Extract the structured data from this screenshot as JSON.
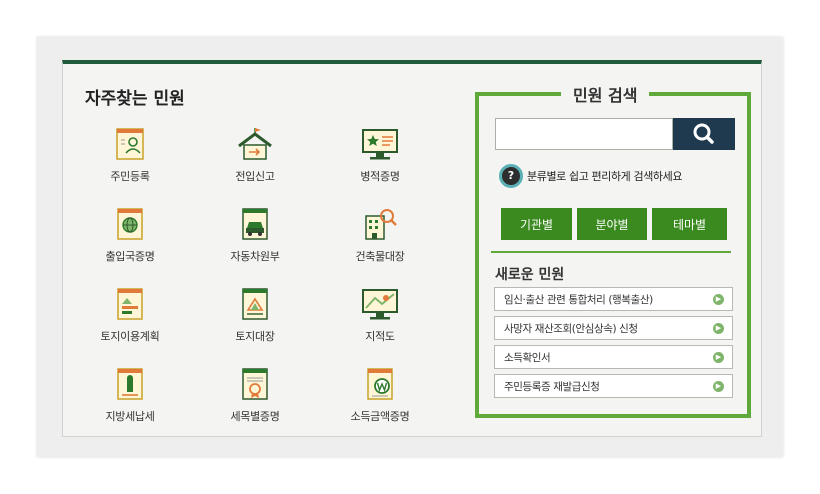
{
  "favorites": {
    "title": "자주찾는 민원",
    "items": [
      {
        "label": "주민등록",
        "icon": "resident-card-icon"
      },
      {
        "label": "전입신고",
        "icon": "house-moving-icon"
      },
      {
        "label": "병적증명",
        "icon": "military-monitor-icon"
      },
      {
        "label": "출입국증명",
        "icon": "globe-document-icon"
      },
      {
        "label": "자동차원부",
        "icon": "car-document-icon"
      },
      {
        "label": "건축물대장",
        "icon": "building-search-icon"
      },
      {
        "label": "토지이용계획",
        "icon": "land-use-icon"
      },
      {
        "label": "토지대장",
        "icon": "land-ledger-icon"
      },
      {
        "label": "지적도",
        "icon": "cadastral-map-icon"
      },
      {
        "label": "지방세납세",
        "icon": "local-tax-icon"
      },
      {
        "label": "세목별증명",
        "icon": "tax-item-icon"
      },
      {
        "label": "소득금액증명",
        "icon": "income-won-icon"
      }
    ]
  },
  "search": {
    "title": "민원 검색",
    "input_value": "",
    "help_symbol": "?",
    "help_text": "분류별로 쉽고 편리하게 검색하세요",
    "categories": [
      "기관별",
      "분야별",
      "테마별"
    ]
  },
  "new_services": {
    "title": "새로운 민원",
    "items": [
      "임신·출산 관련 통합처리 (행복출산)",
      "사망자 재산조회(안심상속) 신청",
      "소득확인서",
      "주민등록증 재발급신청"
    ],
    "arrow": "▶"
  },
  "colors": {
    "top_bar": "#1f5c3c",
    "search_frame": "#5fa83a",
    "category_button": "#3a8a1f",
    "search_button": "#1f3a4f"
  }
}
